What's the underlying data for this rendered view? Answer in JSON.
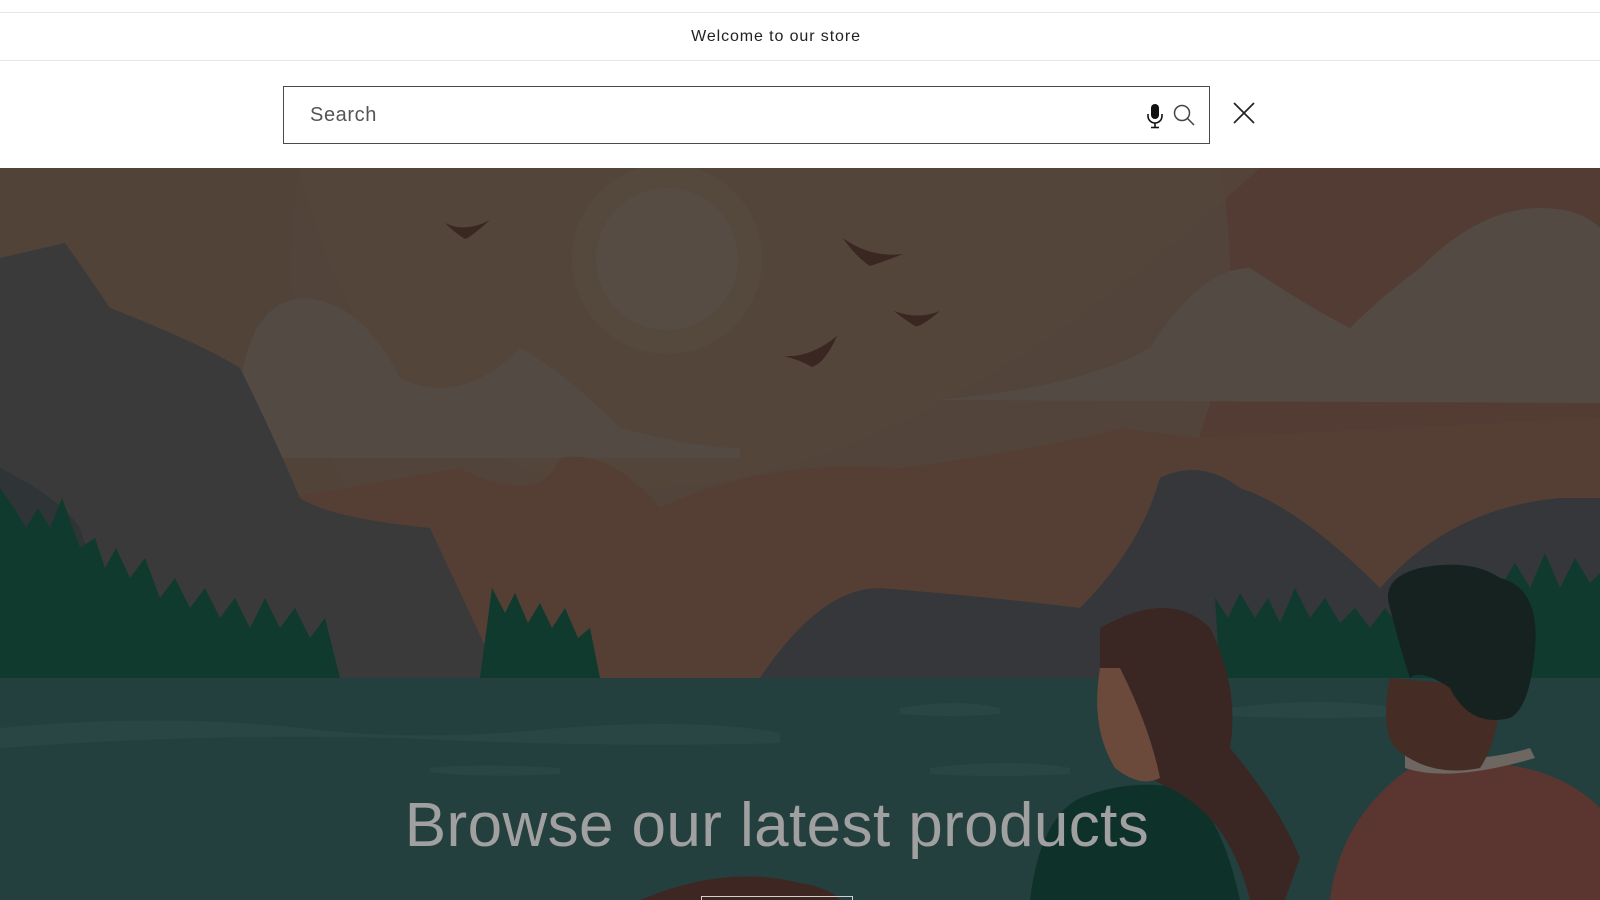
{
  "announcement": {
    "text": "Welcome to our store"
  },
  "search": {
    "placeholder": "Search",
    "value": ""
  },
  "icons": {
    "mic": "microphone-icon",
    "search": "search-icon",
    "close": "close-icon"
  },
  "hero": {
    "title": "Browse our latest products",
    "button_label": ""
  },
  "colors": {
    "border": "#4a4a4a",
    "hero_title": "#a0a0a0",
    "water": "#23403f",
    "sky": "#514338"
  }
}
